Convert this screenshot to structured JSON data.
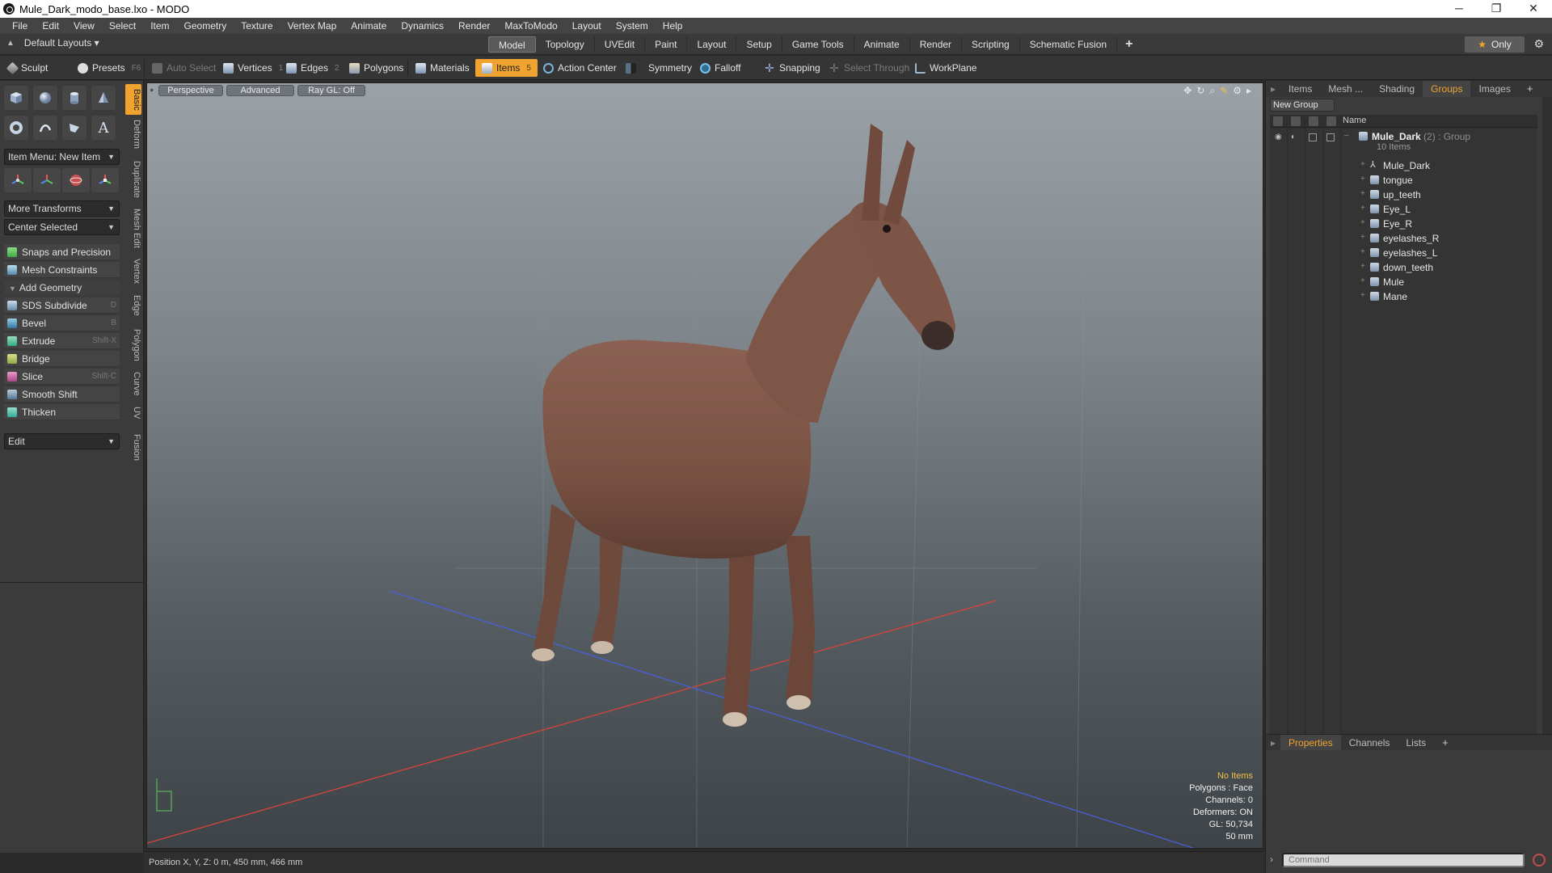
{
  "window": {
    "title": "Mule_Dark_modo_base.lxo - MODO",
    "controls": [
      "─",
      "❐",
      "✕"
    ]
  },
  "menubar": [
    "File",
    "Edit",
    "View",
    "Select",
    "Item",
    "Geometry",
    "Texture",
    "Vertex Map",
    "Animate",
    "Dynamics",
    "Render",
    "MaxToModo",
    "Layout",
    "System",
    "Help"
  ],
  "layoutbar": {
    "layout_label": "Default Layouts ▾",
    "tabs": [
      "Model",
      "Topology",
      "UVEdit",
      "Paint",
      "Layout",
      "Setup",
      "Game Tools",
      "Animate",
      "Render",
      "Scripting",
      "Schematic Fusion"
    ],
    "active_tab": "Model",
    "only_label": "Only"
  },
  "toolbar": {
    "sculpt": "Sculpt",
    "presets": "Presets",
    "presets_key": "F6",
    "auto_select": "Auto Select",
    "vertices": "Vertices",
    "vertices_num": "1",
    "edges": "Edges",
    "edges_num": "2",
    "polygons": "Polygons",
    "materials": "Materials",
    "items": "Items",
    "items_num": "5",
    "action_center": "Action Center",
    "symmetry": "Symmetry",
    "falloff": "Falloff",
    "snapping": "Snapping",
    "select_through": "Select Through",
    "workplane": "WorkPlane"
  },
  "leftpanel": {
    "vtabs": [
      "Basic",
      "Deform",
      "Duplicate",
      "Mesh Edit",
      "Vertex",
      "Edge",
      "Polygon",
      "Curve",
      "UV",
      "Fusion"
    ],
    "item_menu": "Item Menu: New Item",
    "more_transforms": "More Transforms",
    "center_selected": "Center Selected",
    "snaps": "Snaps and Precision",
    "mesh_constraints": "Mesh Constraints",
    "add_geometry": "Add Geometry",
    "tools": [
      {
        "label": "SDS Subdivide",
        "key": "D"
      },
      {
        "label": "Bevel",
        "key": "B"
      },
      {
        "label": "Extrude",
        "key": "Shift-X"
      },
      {
        "label": "Bridge",
        "key": ""
      },
      {
        "label": "Slice",
        "key": "Shift-C"
      },
      {
        "label": "Smooth Shift",
        "key": ""
      },
      {
        "label": "Thicken",
        "key": ""
      }
    ],
    "edit_dropdown": "Edit"
  },
  "viewport": {
    "view_mode": "Perspective",
    "advanced": "Advanced",
    "raygl": "Ray GL: Off",
    "stats": {
      "no_items": "No Items",
      "polygons": "Polygons : Face",
      "channels": "Channels: 0",
      "deformers": "Deformers: ON",
      "gl": "GL: 50,734",
      "lens": "50 mm"
    }
  },
  "statusbar": {
    "position": "Position X, Y, Z:   0 m, 450 mm, 466 mm"
  },
  "rightpanel": {
    "tabs": [
      "Items",
      "Mesh ...",
      "Shading",
      "Groups",
      "Images"
    ],
    "active_tab": "Groups",
    "new_group": "New Group",
    "name_header": "Name",
    "group": {
      "name": "Mule_Dark",
      "meta": "(2) : Group",
      "count": "10 Items"
    },
    "items": [
      "Mule_Dark",
      "tongue",
      "up_teeth",
      "Eye_L",
      "Eye_R",
      "eyelashes_R",
      "eyelashes_L",
      "down_teeth",
      "Mule",
      "Mane"
    ],
    "bottom_tabs": [
      "Properties",
      "Channels",
      "Lists"
    ],
    "active_bottom_tab": "Properties",
    "command_placeholder": "Command"
  },
  "colors": {
    "accent": "#f0a330",
    "panel": "#3b3b3b",
    "viewport_top": "#9aa2a8",
    "viewport_bottom": "#3d4347"
  }
}
